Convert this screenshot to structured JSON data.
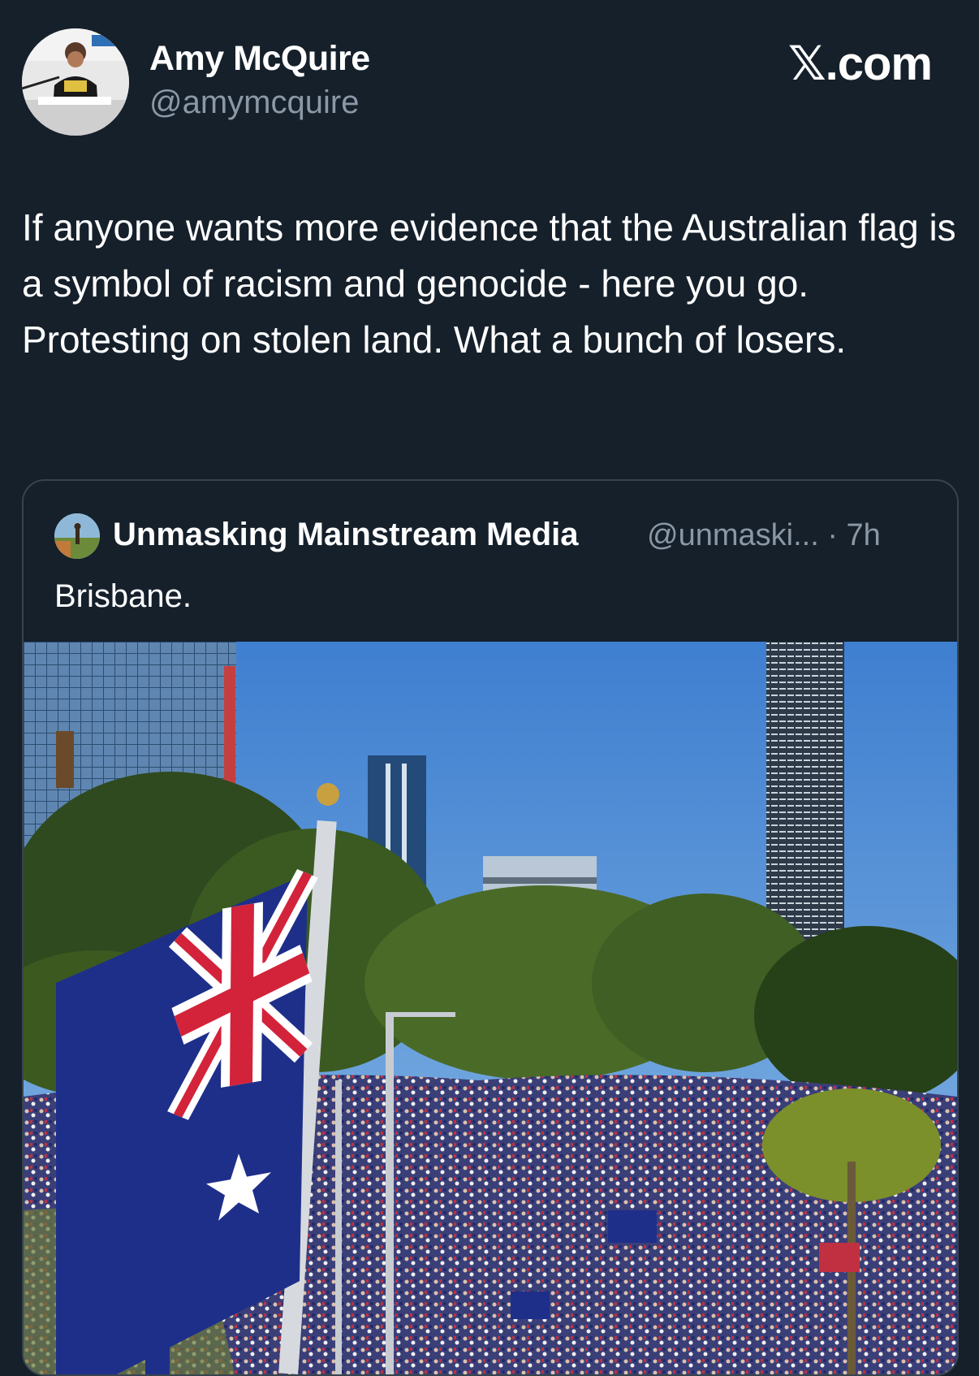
{
  "author": {
    "name": "Amy McQuire",
    "handle": "@amymcquire",
    "avatar_icon": "profile-photo"
  },
  "brand": {
    "mark": "𝕏",
    "suffix": ".com"
  },
  "tweet": {
    "text": "If anyone wants more evidence that the Australian flag is a symbol of racism and genocide - here you go. Protesting on stolen land. What a bunch of losers."
  },
  "quoted_tweet": {
    "name": "Unmasking Mainstream Media",
    "handle": "@unmaski...",
    "separator": "·",
    "time": "7h",
    "text": "Brisbane.",
    "media_description_icon": "photo-crowd-with-australian-flags"
  },
  "colors": {
    "background": "#15202b",
    "secondary_text": "#8b98a5",
    "border": "#38444d",
    "primary_text": "#ffffff"
  }
}
